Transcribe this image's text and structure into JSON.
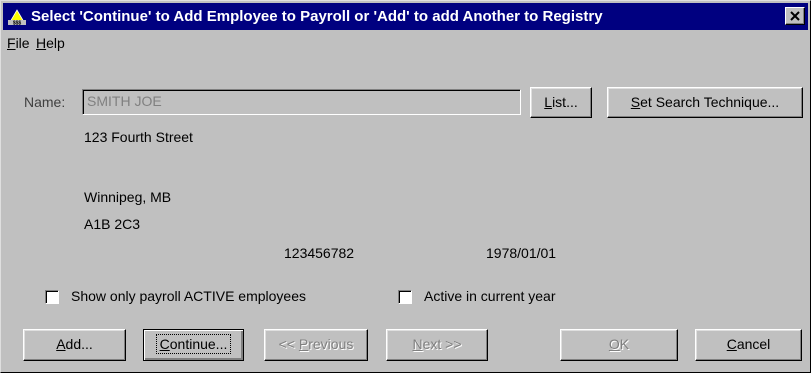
{
  "window": {
    "title": "Select 'Continue' to Add Employee to Payroll or 'Add' to add Another to Registry"
  },
  "menu": {
    "file": {
      "accel": "F",
      "rest": "ile"
    },
    "help": {
      "accel": "H",
      "rest": "elp"
    }
  },
  "name": {
    "label": "Name:",
    "value": "SMITH JOE"
  },
  "buttons": {
    "list": {
      "accel": "L",
      "rest": "ist..."
    },
    "search": {
      "accel": "S",
      "rest": "et Search Technique..."
    },
    "add": {
      "accel": "A",
      "rest": "dd..."
    },
    "continue": {
      "accel": "C",
      "rest": "ontinue..."
    },
    "previous": {
      "pre": "<< ",
      "accel": "P",
      "rest": "revious"
    },
    "next": {
      "accel": "N",
      "rest": "ext >>"
    },
    "ok": {
      "accel": "O",
      "rest": "K"
    },
    "cancel": {
      "accel": "C",
      "rest": "ancel"
    }
  },
  "address": {
    "line1": "123 Fourth Street",
    "line2": "",
    "city": "Winnipeg, MB",
    "postal": "A1B 2C3"
  },
  "employee": {
    "sin": "123456782",
    "birth_date": "1978/01/01"
  },
  "options": {
    "active_only": {
      "label": "Show only payroll ACTIVE employees",
      "checked": false
    },
    "current_year": {
      "label": "Active in current year",
      "checked": false
    }
  }
}
